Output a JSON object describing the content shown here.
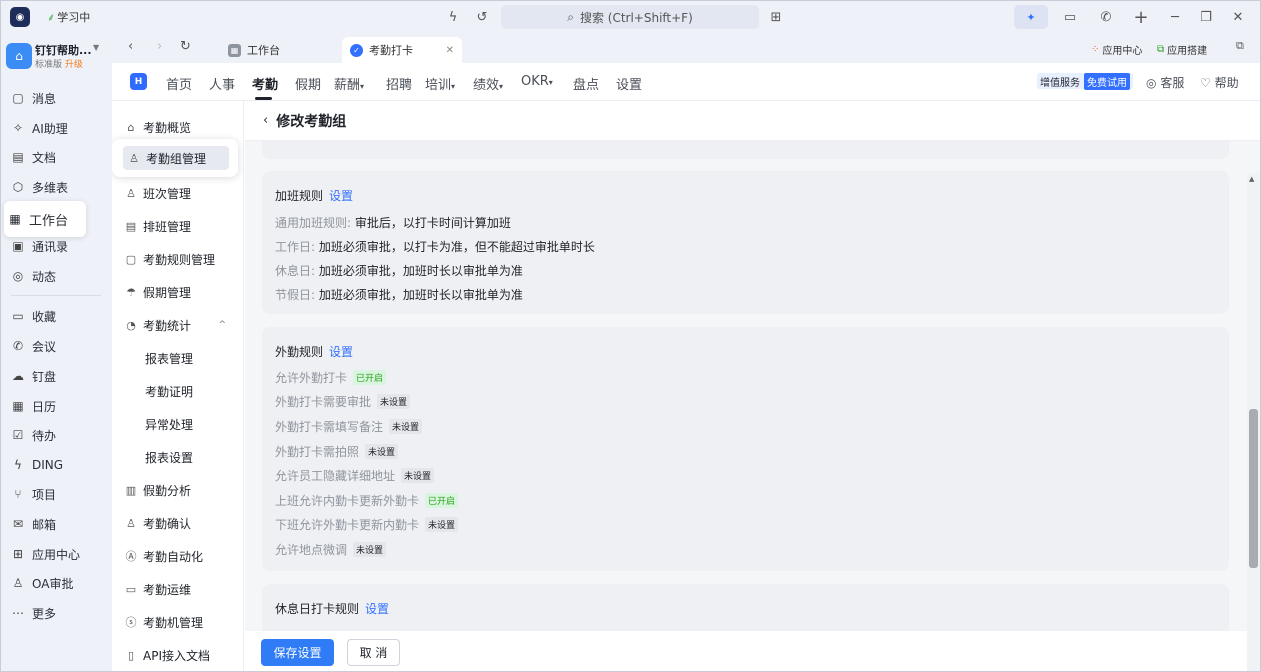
{
  "titlebar": {
    "status": "学习中",
    "search_placeholder": "搜索 (Ctrl+Shift+F)"
  },
  "profile": {
    "name": "钉钉帮助...",
    "edition": "标准版",
    "upgrade": "升级"
  },
  "leftnav": {
    "items": [
      {
        "label": "消息",
        "icon": "message-icon"
      },
      {
        "label": "AI助理",
        "icon": "ai-assistant-icon"
      },
      {
        "label": "文档",
        "icon": "document-icon"
      },
      {
        "label": "多维表",
        "icon": "multi-table-icon"
      },
      {
        "label": "工作台",
        "icon": "workbench-icon"
      },
      {
        "label": "通讯录",
        "icon": "contacts-icon"
      },
      {
        "label": "动态",
        "icon": "moments-icon"
      },
      {
        "label": "收藏",
        "icon": "favorites-icon"
      },
      {
        "label": "会议",
        "icon": "meeting-icon"
      },
      {
        "label": "钉盘",
        "icon": "drive-icon"
      },
      {
        "label": "日历",
        "icon": "calendar-icon"
      },
      {
        "label": "待办",
        "icon": "todo-icon"
      },
      {
        "label": "DING",
        "icon": "ding-icon"
      },
      {
        "label": "项目",
        "icon": "project-icon"
      },
      {
        "label": "邮箱",
        "icon": "mail-icon"
      },
      {
        "label": "应用中心",
        "icon": "app-center-icon"
      },
      {
        "label": "OA审批",
        "icon": "approval-icon"
      },
      {
        "label": "更多",
        "icon": "more-icon"
      }
    ]
  },
  "tabs": [
    {
      "label": "工作台"
    },
    {
      "label": "考勤打卡"
    }
  ],
  "tab_right": {
    "app_center": "应用中心",
    "app_build": "应用搭建"
  },
  "appnav": {
    "menus": [
      "首页",
      "人事",
      "考勤",
      "假期",
      "薪酬",
      "招聘",
      "培训",
      "绩效",
      "OKR",
      "盘点",
      "设置"
    ],
    "value_service": "增值服务",
    "free_trial": "免费试用",
    "support": "客服",
    "help": "帮助"
  },
  "subside": {
    "overview": "考勤概览",
    "group_mgmt": "考勤组管理",
    "shift_mgmt": "班次管理",
    "schedule_mgmt": "排班管理",
    "rules_mgmt": "考勤规则管理",
    "holiday_mgmt": "假期管理",
    "stats": "考勤统计",
    "report_mgmt": "报表管理",
    "certificate": "考勤证明",
    "exception": "异常处理",
    "report_settings": "报表设置",
    "leave_analysis": "假勤分析",
    "confirm": "考勤确认",
    "automation": "考勤自动化",
    "ops": "考勤运维",
    "machine": "考勤机管理",
    "api_docs": "API接入文档"
  },
  "page": {
    "title": "修改考勤组",
    "set_label": "设置"
  },
  "overtime": {
    "title": "加班规则",
    "general_label": "通用加班规则:",
    "general_value": "审批后，以打卡时间计算加班",
    "workday_label": "工作日:",
    "workday_value": "加班必须审批，以打卡为准，但不能超过审批单时长",
    "restday_label": "休息日:",
    "restday_value": "加班必须审批，加班时长以审批单为准",
    "holiday_label": "节假日:",
    "holiday_value": "加班必须审批，加班时长以审批单为准"
  },
  "field": {
    "title": "外勤规则",
    "rows": [
      {
        "label": "允许外勤打卡",
        "status": "已开启",
        "on": true
      },
      {
        "label": "外勤打卡需要审批",
        "status": "未设置",
        "on": false
      },
      {
        "label": "外勤打卡需填写备注",
        "status": "未设置",
        "on": false
      },
      {
        "label": "外勤打卡需拍照",
        "status": "未设置",
        "on": false
      },
      {
        "label": "允许员工隐藏详细地址",
        "status": "未设置",
        "on": false
      },
      {
        "label": "上班允许内勤卡更新外勤卡",
        "status": "已开启",
        "on": true
      },
      {
        "label": "下班允许外勤卡更新内勤卡",
        "status": "未设置",
        "on": false
      },
      {
        "label": "允许地点微调",
        "status": "未设置",
        "on": false
      }
    ]
  },
  "restday": {
    "title": "休息日打卡规则"
  },
  "footer": {
    "save": "保存设置",
    "cancel": "取 消"
  }
}
